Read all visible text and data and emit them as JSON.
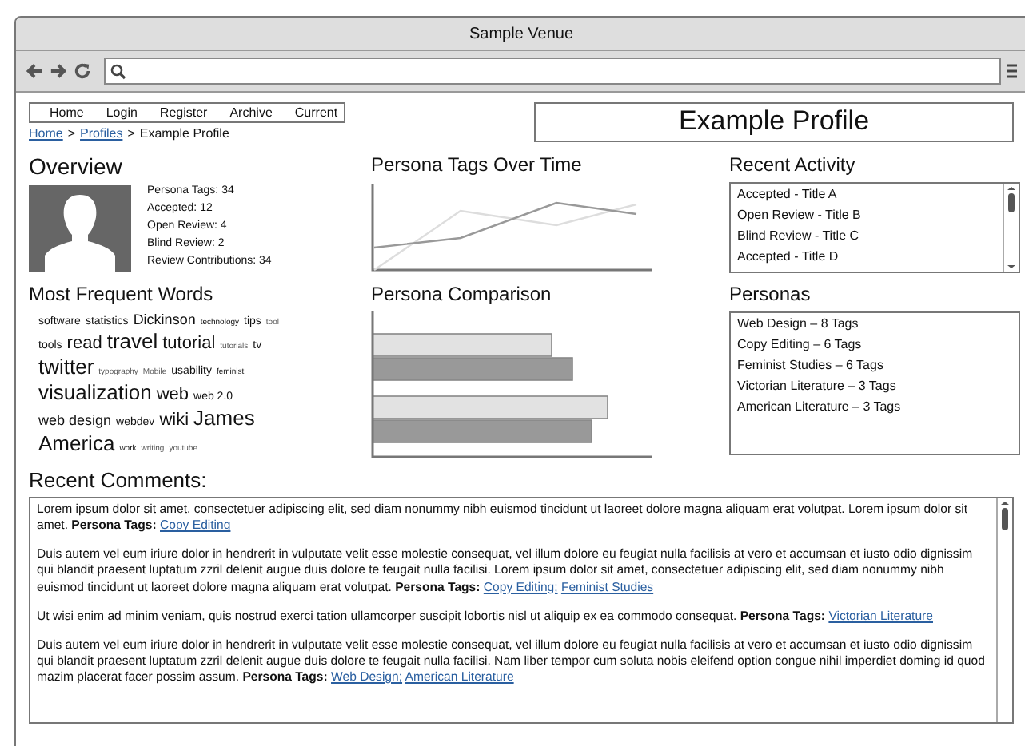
{
  "window": {
    "title": "Sample Venue"
  },
  "nav": [
    "Home",
    "Login",
    "Register",
    "Archive",
    "Current"
  ],
  "page_title": "Example Profile",
  "breadcrumb": [
    {
      "label": "Home",
      "kind": "link"
    },
    {
      "label": ">",
      "kind": "sep"
    },
    {
      "label": "Profiles",
      "kind": "link"
    },
    {
      "label": ">",
      "kind": "sep"
    },
    {
      "label": "Example Profile",
      "kind": "text"
    }
  ],
  "overview": {
    "title": "Overview",
    "stats": [
      "Persona Tags: 34",
      "Accepted: 12",
      "Open Review: 4",
      "Blind Review: 2",
      "Review Contributions: 34"
    ]
  },
  "words": {
    "title": "Most Frequent Words",
    "lines": [
      [
        {
          "text": "software",
          "kind": "s"
        },
        {
          "text": "statistics",
          "kind": "s"
        },
        {
          "text": "Dickinson",
          "kind": "m"
        },
        {
          "text": "technology",
          "kind": "xs"
        },
        {
          "text": "tips",
          "kind": "s"
        },
        {
          "text": "tool",
          "kind": "xxs"
        }
      ],
      [
        {
          "text": "tools",
          "kind": "s"
        },
        {
          "text": "read",
          "kind": "l"
        },
        {
          "text": "travel",
          "kind": "xl"
        },
        {
          "text": "tutorial",
          "kind": "l"
        },
        {
          "text": "tutorials",
          "kind": "xxs"
        },
        {
          "text": "tv",
          "kind": "s"
        }
      ],
      [
        {
          "text": "twitter",
          "kind": "xl"
        },
        {
          "text": "typography",
          "kind": "xxs"
        },
        {
          "text": "Mobile",
          "kind": "xxs"
        },
        {
          "text": "usability",
          "kind": "s"
        },
        {
          "text": "feminist",
          "kind": "xs"
        }
      ],
      [
        {
          "text": "visualization",
          "kind": "xl"
        },
        {
          "text": "web",
          "kind": "l"
        },
        {
          "text": "web 2.0",
          "kind": "s"
        }
      ],
      [
        {
          "text": "web design",
          "kind": "m"
        },
        {
          "text": "webdev",
          "kind": "s"
        },
        {
          "text": "wiki",
          "kind": "l"
        },
        {
          "text": "James",
          "kind": "xl"
        }
      ],
      [
        {
          "text": "America",
          "kind": "xl"
        },
        {
          "text": "work",
          "kind": "xs"
        },
        {
          "text": "writing",
          "kind": "xxs"
        },
        {
          "text": "youtube",
          "kind": "xxs"
        }
      ]
    ]
  },
  "tags_chart": {
    "title": "Persona Tags Over Time"
  },
  "comparison_chart": {
    "title": "Persona Comparison"
  },
  "recent_activity": {
    "title": "Recent Activity",
    "items": [
      "Accepted -  Title A",
      "Open Review -  Title B",
      "Blind Review -  Title C",
      "Accepted -  Title D"
    ]
  },
  "personas": {
    "title": "Personas",
    "items": [
      "Web Design – 8 Tags",
      "Copy Editing – 6 Tags",
      "Feminist Studies – 6 Tags",
      "Victorian Literature – 3 Tags",
      "American Literature – 3 Tags"
    ]
  },
  "comments": {
    "title": "Recent Comments:",
    "items": [
      {
        "text": "Lorem ipsum dolor sit amet, consectetuer adipiscing elit, sed diam nonummy nibh euismod tincidunt ut laoreet dolore magna aliquam erat volutpat. Lorem ipsum dolor sit amet.",
        "tags_label": "Persona Tags:",
        "tags": [
          "Copy Editing"
        ]
      },
      {
        "text": "Duis autem vel eum iriure dolor in hendrerit in vulputate velit esse molestie consequat, vel illum dolore eu feugiat nulla facilisis at vero et accumsan et iusto odio dignissim qui blandit praesent luptatum zzril delenit augue duis dolore te feugait nulla facilisi. Lorem ipsum dolor sit amet, consectetuer adipiscing elit, sed diam nonummy nibh euismod tincidunt ut laoreet dolore magna aliquam erat volutpat.",
        "tags_label": "Persona Tags:",
        "tags": [
          "Copy Editing;",
          "Feminist Studies"
        ]
      },
      {
        "text": "Ut wisi enim ad minim veniam, quis nostrud exerci tation ullamcorper suscipit lobortis nisl ut aliquip ex ea commodo consequat.",
        "tags_label": "Persona Tags:",
        "tags": [
          "Victorian Literature"
        ]
      },
      {
        "text": "Duis autem vel eum iriure dolor in hendrerit in vulputate velit esse molestie consequat, vel illum dolore eu feugiat nulla facilisis at vero et accumsan et iusto odio dignissim qui blandit praesent luptatum zzril delenit augue duis dolore te feugait nulla facilisi. Nam liber tempor cum soluta nobis eleifend option congue nihil imperdiet doming id quod mazim placerat facer possim assum.",
        "tags_label": "Persona Tags:",
        "tags": [
          "Web Design;",
          "American Literature"
        ]
      }
    ]
  }
}
